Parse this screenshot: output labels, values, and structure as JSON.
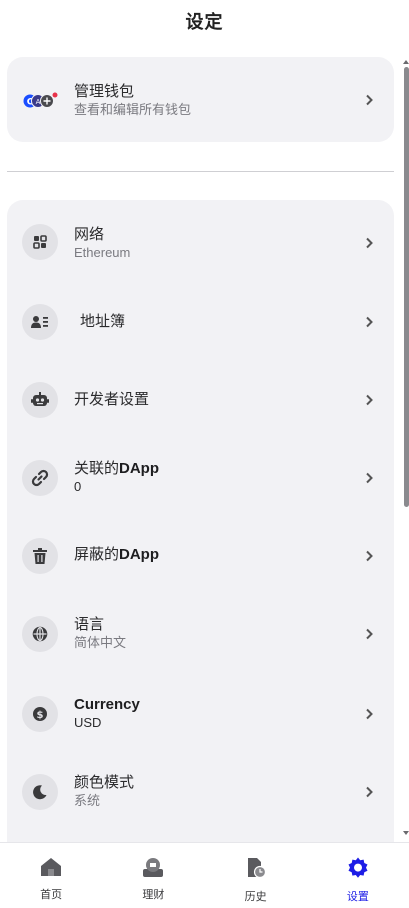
{
  "header": {
    "title": "设定"
  },
  "wallet_card": {
    "label": "管理钱包",
    "sub": "查看和编辑所有钱包",
    "icons": [
      "wallet-c-icon",
      "wallet-a-icon",
      "wallet-add-icon"
    ]
  },
  "settings": [
    {
      "key": "network",
      "label": "网络",
      "sub": "Ethereum",
      "icon": "network-grid-icon"
    },
    {
      "key": "address-book",
      "label": "地址簿",
      "sub": "",
      "icon": "contacts-icon"
    },
    {
      "key": "developer",
      "label": "开发者设置",
      "sub": "",
      "icon": "robot-icon"
    },
    {
      "key": "connected-dapps",
      "label_prefix": "关联的",
      "label_bold": "DApp",
      "sub": "0",
      "icon": "link-icon"
    },
    {
      "key": "blocked-dapps",
      "label_prefix": "屏蔽的",
      "label_bold": "DApp",
      "sub": "",
      "icon": "trash-icon"
    },
    {
      "key": "language",
      "label": "语言",
      "sub": "简体中文",
      "icon": "globe-icon"
    },
    {
      "key": "currency",
      "label": "Currency",
      "sub": "USD",
      "icon": "dollar-icon"
    },
    {
      "key": "color-mode",
      "label": "颜色模式",
      "sub": "系统",
      "icon": "moon-icon"
    }
  ],
  "tabs": [
    {
      "key": "home",
      "label": "首页",
      "icon": "home-icon",
      "active": false
    },
    {
      "key": "finance",
      "label": "理财",
      "icon": "finance-icon",
      "active": false
    },
    {
      "key": "history",
      "label": "历史",
      "icon": "history-icon",
      "active": false
    },
    {
      "key": "settings",
      "label": "设置",
      "icon": "gear-icon",
      "active": true
    }
  ],
  "colors": {
    "accent": "#1d1de6",
    "card_bg": "#f2f2f5",
    "icon_bg": "#e2e2e6"
  }
}
